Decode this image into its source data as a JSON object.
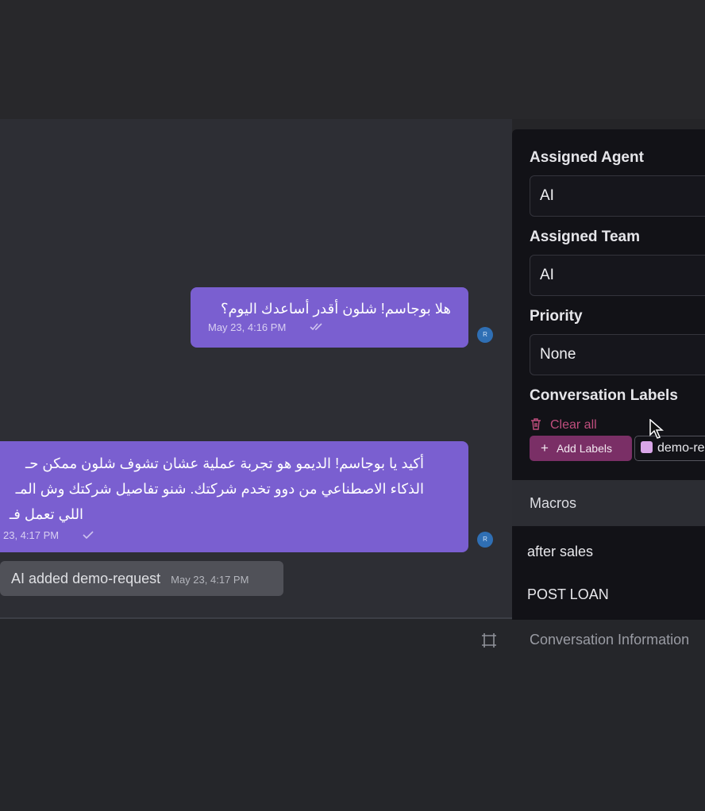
{
  "chat": {
    "messages": [
      {
        "text": "هلا بوجاسم! شلون أقدر أساعدك اليوم؟",
        "timestamp": "May 23, 4:16 PM",
        "status_icon": "double-check-icon"
      },
      {
        "lines": [
          "أكيد يا بوجاسم! الديمو هو تجربة عملية عشان تشوف شلون ممكن حـ",
          "الذكاء الاصطناعي من دوو تخدم شركتك. شنو تفاصيل شركتك وش المـ",
          "اللي تعمل فـ"
        ],
        "timestamp": "23, 4:17 PM",
        "status_icon": "check-icon"
      }
    ],
    "activity": {
      "text": "AI added demo-request",
      "timestamp": "May 23, 4:17 PM"
    },
    "avatar_initial": "R"
  },
  "sidebar": {
    "assigned_agent": {
      "label": "Assigned Agent",
      "value": "AI"
    },
    "assigned_team": {
      "label": "Assigned Team",
      "value": "AI"
    },
    "priority": {
      "label": "Priority",
      "value": "None"
    },
    "labels": {
      "title": "Conversation Labels",
      "clear_all": "Clear all",
      "add_button": "Add Labels",
      "chip": "demo-re",
      "chip_color": "#d9a6e8"
    },
    "macros": {
      "title": "Macros",
      "items": [
        "after sales",
        "POST LOAN"
      ]
    },
    "conversation_information": "Conversation Information"
  },
  "colors": {
    "bubble": "#7a5fd0",
    "label_button": "#7a2f66",
    "clear_all": "#c04e7e"
  }
}
